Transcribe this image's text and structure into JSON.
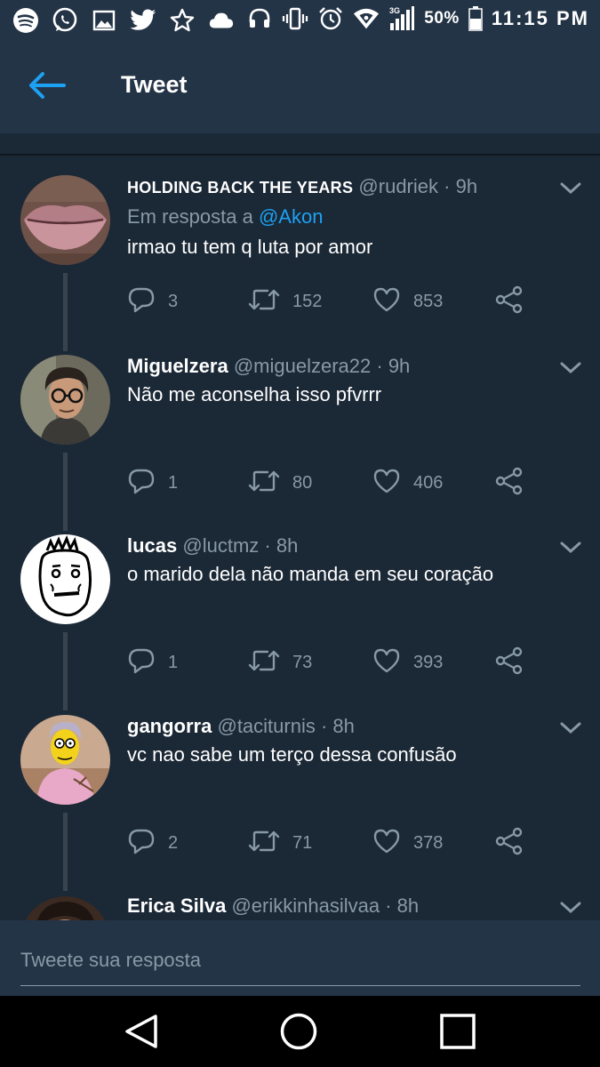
{
  "status_bar": {
    "battery": "50%",
    "time": "11:15 PM",
    "network": "3G",
    "icons_left": [
      "spotify-icon",
      "whatsapp-icon",
      "gallery-icon",
      "twitter-icon",
      "star-icon",
      "cloud-icon"
    ],
    "icons_right": [
      "headphones-icon",
      "vibrate-icon",
      "alarm-icon",
      "wifi-icon",
      "signal-icon",
      "battery-icon"
    ]
  },
  "header": {
    "title": "Tweet"
  },
  "tweets": [
    {
      "name": "HOLDING BACK THE YEARS",
      "handle": "@rudriek",
      "time": "· 9h",
      "reply_prefix": "Em resposta a",
      "reply_to": "@Akon",
      "text": "irmao tu tem q luta por amor",
      "replies": "3",
      "retweets": "152",
      "likes": "853"
    },
    {
      "name": "Miguelzera",
      "handle": "@miguelzera22",
      "time": "· 9h",
      "text": "Não me aconselha isso pfvrrr",
      "replies": "1",
      "retweets": "80",
      "likes": "406"
    },
    {
      "name": "lucas",
      "handle": "@luctmz",
      "time": "· 8h",
      "text": "o marido dela não manda em seu coração",
      "replies": "1",
      "retweets": "73",
      "likes": "393"
    },
    {
      "name": "gangorra",
      "handle": "@taciturnis",
      "time": "· 8h",
      "text": "vc nao sabe um terço dessa confusão",
      "replies": "2",
      "retweets": "71",
      "likes": "378"
    },
    {
      "name": "Erica Silva",
      "handle": "@erikkinhasilvaa",
      "time": "· 8h"
    }
  ],
  "reply_box": {
    "placeholder": "Tweete sua resposta"
  },
  "colors": {
    "background": "#1b2836",
    "header": "#243447",
    "accent": "#1da1f2",
    "muted": "#8899a6"
  }
}
